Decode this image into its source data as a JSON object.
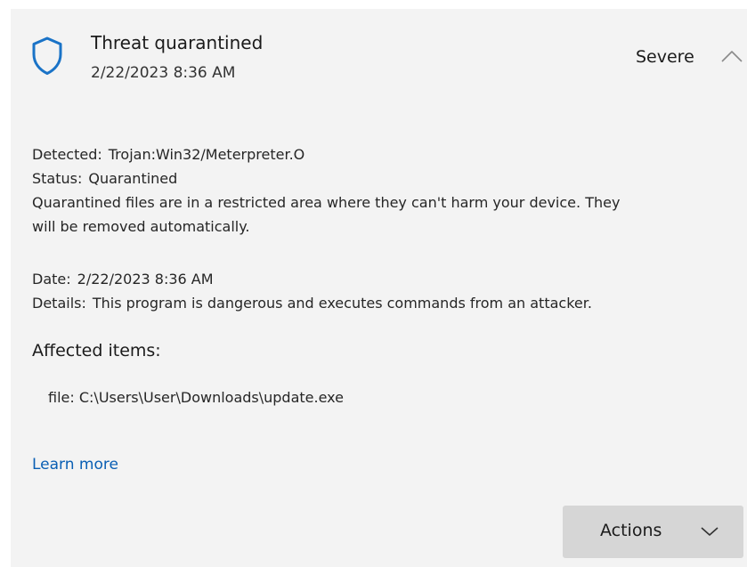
{
  "header": {
    "title": "Threat quarantined",
    "timestamp": "2/22/2023 8:36 AM",
    "severity": "Severe",
    "icon": "shield-icon",
    "accent_color": "#1a73c7"
  },
  "details": {
    "detected_label": "Detected:",
    "detected_value": "Trojan:Win32/Meterpreter.O",
    "status_label": "Status:",
    "status_value": "Quarantined",
    "status_description_line1": "Quarantined files are in a restricted area where they can't harm your device. They",
    "status_description_line2": "will be removed automatically.",
    "date_label": "Date:",
    "date_value": "2/22/2023 8:36 AM",
    "details_label": "Details:",
    "details_value": "This program is dangerous and executes commands from an attacker."
  },
  "affected": {
    "title": "Affected items:",
    "items": [
      {
        "label": "file:",
        "path": "C:\\Users\\User\\Downloads\\update.exe"
      }
    ]
  },
  "links": {
    "learn_more": "Learn more",
    "link_color": "#0a5fb4"
  },
  "actions": {
    "label": "Actions"
  }
}
